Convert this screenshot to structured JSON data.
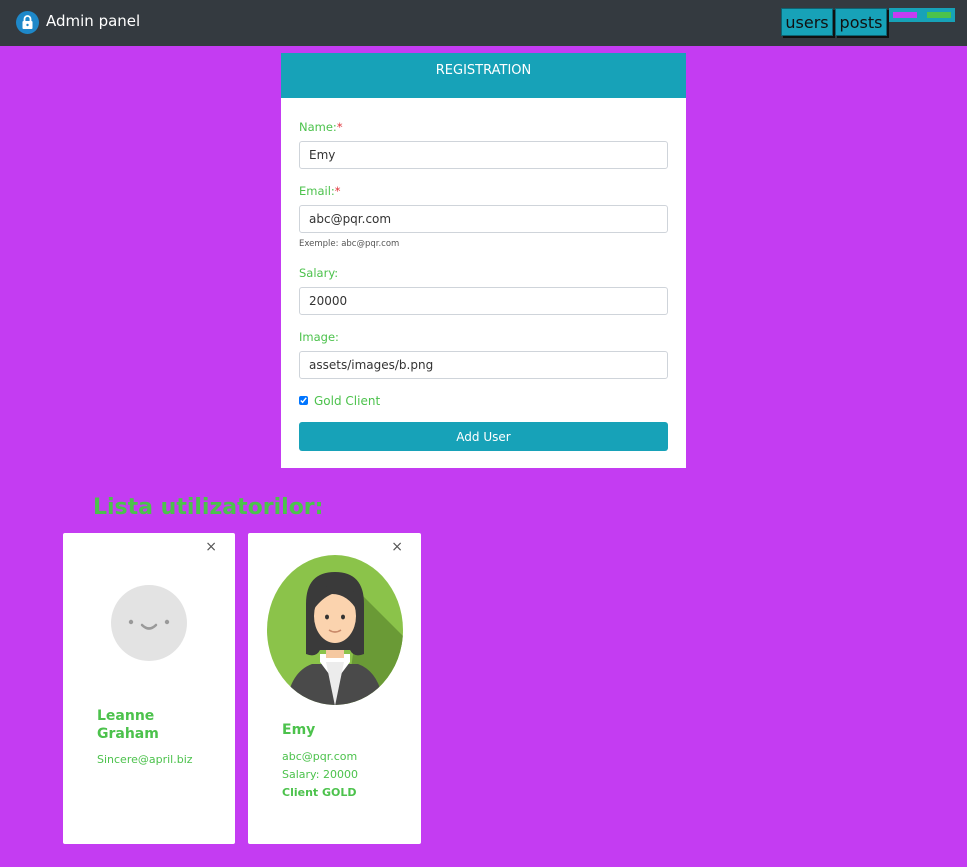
{
  "navbar": {
    "title": "Admin panel",
    "icon": "lock-icon",
    "nav_users": "users",
    "nav_posts": "posts",
    "theme_colors": [
      "#c43cf2",
      "#4cc24c"
    ]
  },
  "registration": {
    "title": "REGISTRATION",
    "name_label": "Name:",
    "required_mark": "*",
    "name_value": "Emy",
    "email_label": "Email:",
    "email_value": "abc@pqr.com",
    "email_hint": "Exemple: abc@pqr.com",
    "salary_label": "Salary:",
    "salary_value": "20000",
    "image_label": "Image:",
    "image_value": "assets/images/b.png",
    "gold_label": "Gold Client",
    "gold_checked": true,
    "submit_label": "Add User"
  },
  "users_list": {
    "heading": "Lista utilizatorilor:",
    "close_glyph": "×",
    "users": [
      {
        "name_line1": "Leanne",
        "name_line2": "Graham",
        "email": "Sincere@april.biz",
        "avatar": "default-avatar-icon"
      },
      {
        "name": "Emy",
        "email": "abc@pqr.com",
        "salary": "Salary: 20000",
        "client_status": "Client GOLD",
        "avatar": "woman-avatar-photo"
      }
    ]
  },
  "colors": {
    "background": "#c43cf2",
    "navbar": "#343a40",
    "accent": "#17a2b8",
    "text_green": "#4cc24c",
    "required": "#e0333a"
  }
}
